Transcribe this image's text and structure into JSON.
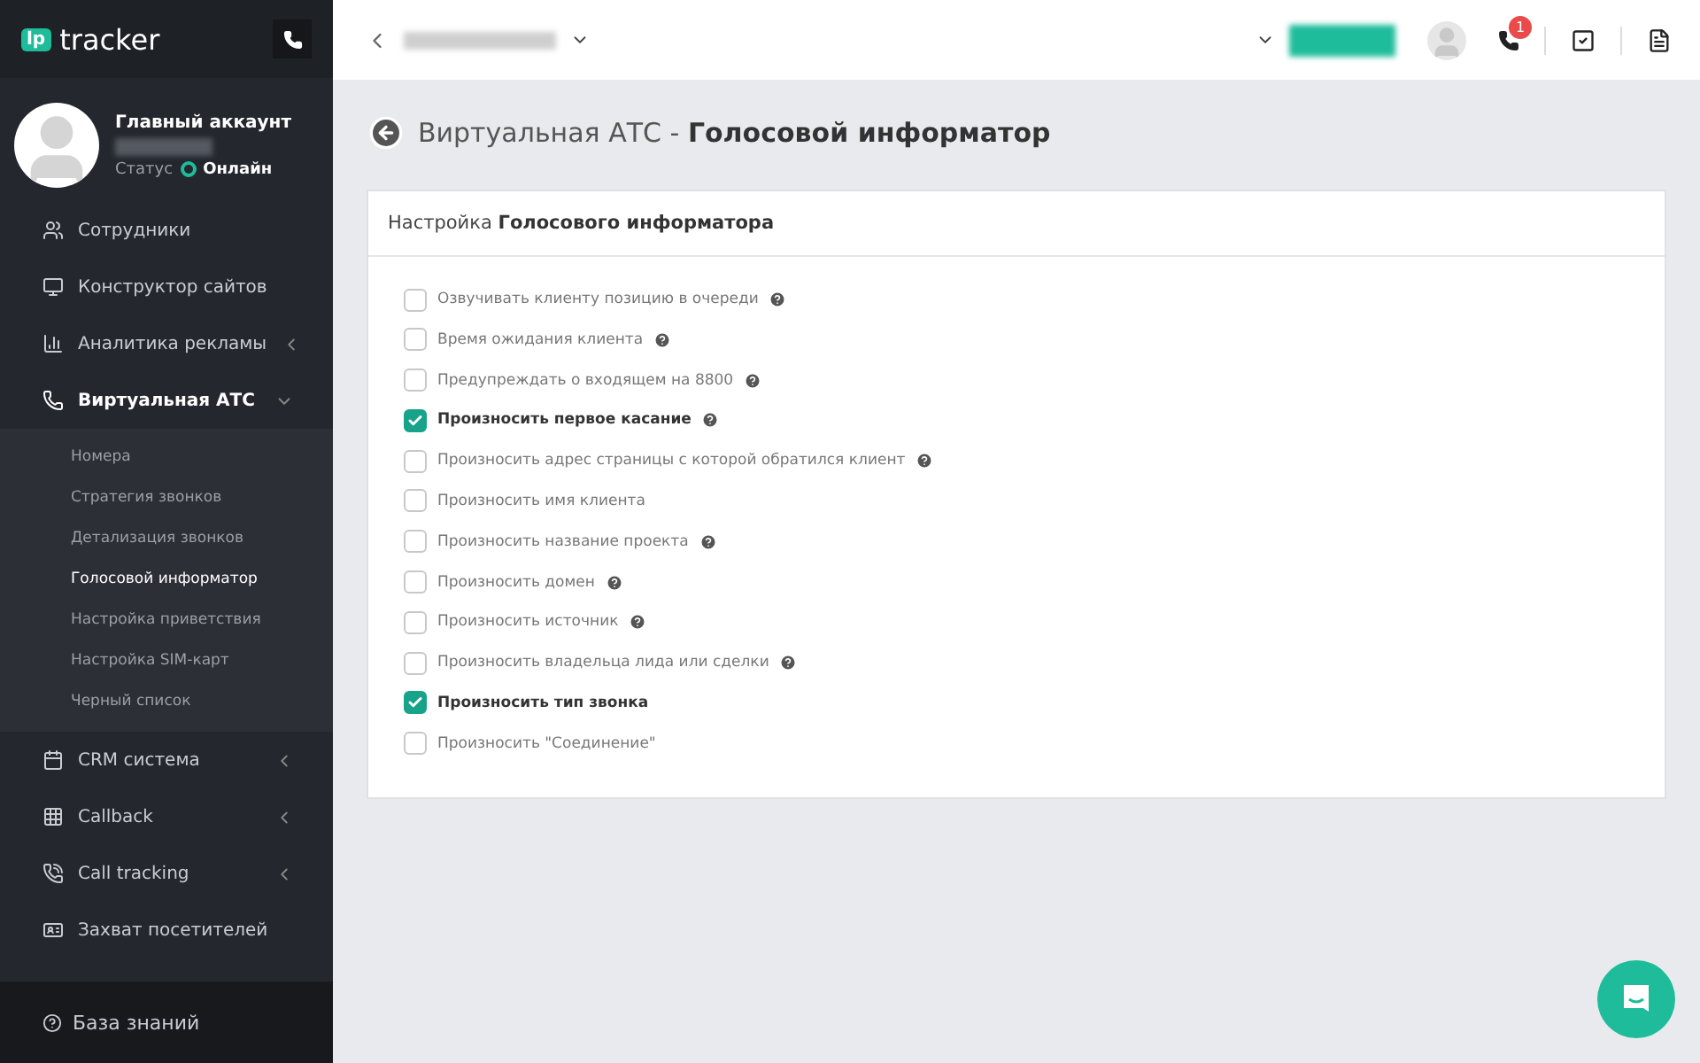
{
  "logo": {
    "badge": "lp",
    "name": "tracker"
  },
  "account": {
    "name": "Главный аккаунт",
    "status_label": "Статус",
    "status": "Онлайн",
    "online": true
  },
  "menu": [
    {
      "label": "Сотрудники",
      "expanded": false,
      "has_arrow": false
    },
    {
      "label": "Конструктор сайтов",
      "expanded": false,
      "has_arrow": false
    },
    {
      "label": "Аналитика рекламы",
      "expanded": false,
      "has_arrow": true
    },
    {
      "label": "Виртуальная АТС",
      "expanded": true,
      "has_arrow": true,
      "children": [
        {
          "label": "Номера",
          "selected": false
        },
        {
          "label": "Стратегия звонков",
          "selected": false
        },
        {
          "label": "Детализация звонков",
          "selected": false
        },
        {
          "label": "Голосовой информатор",
          "selected": true
        },
        {
          "label": "Настройка приветствия",
          "selected": false
        },
        {
          "label": "Настройка SIM-карт",
          "selected": false
        },
        {
          "label": "Черный список",
          "selected": false
        }
      ]
    },
    {
      "label": "CRM система",
      "expanded": false,
      "has_arrow": true
    },
    {
      "label": "Callback",
      "expanded": false,
      "has_arrow": true
    },
    {
      "label": "Call tracking",
      "expanded": false,
      "has_arrow": true
    },
    {
      "label": "Захват посетителей",
      "expanded": false,
      "has_arrow": false
    }
  ],
  "footer": {
    "label": "База знаний"
  },
  "topbar": {
    "notification_count": "1"
  },
  "page": {
    "title_prefix": "Виртуальная АТС - ",
    "title": "Голосовой информатор"
  },
  "card": {
    "title_prefix": "Настройка ",
    "title": "Голосового информатора",
    "options": [
      {
        "label": "Озвучивать клиенту позицию в очереди",
        "checked": false,
        "help": true
      },
      {
        "label": "Время ожидания клиента",
        "checked": false,
        "help": true
      },
      {
        "label": "Предупреждать о входящем на 8800",
        "checked": false,
        "help": true
      },
      {
        "label": "Произносить первое касание",
        "checked": true,
        "help": true
      },
      {
        "label": "Произносить адрес страницы с которой обратился клиент",
        "checked": false,
        "help": true
      },
      {
        "label": "Произносить имя клиента",
        "checked": false,
        "help": false
      },
      {
        "label": "Произносить название проекта",
        "checked": false,
        "help": true
      },
      {
        "label": "Произносить домен",
        "checked": false,
        "help": true
      },
      {
        "label": "Произносить источник",
        "checked": false,
        "help": true
      },
      {
        "label": "Произносить владельца лида или сделки",
        "checked": false,
        "help": true
      },
      {
        "label": "Произносить тип звонка",
        "checked": true,
        "help": false
      },
      {
        "label": "Произносить \"Соединение\"",
        "checked": false,
        "help": false
      }
    ]
  }
}
